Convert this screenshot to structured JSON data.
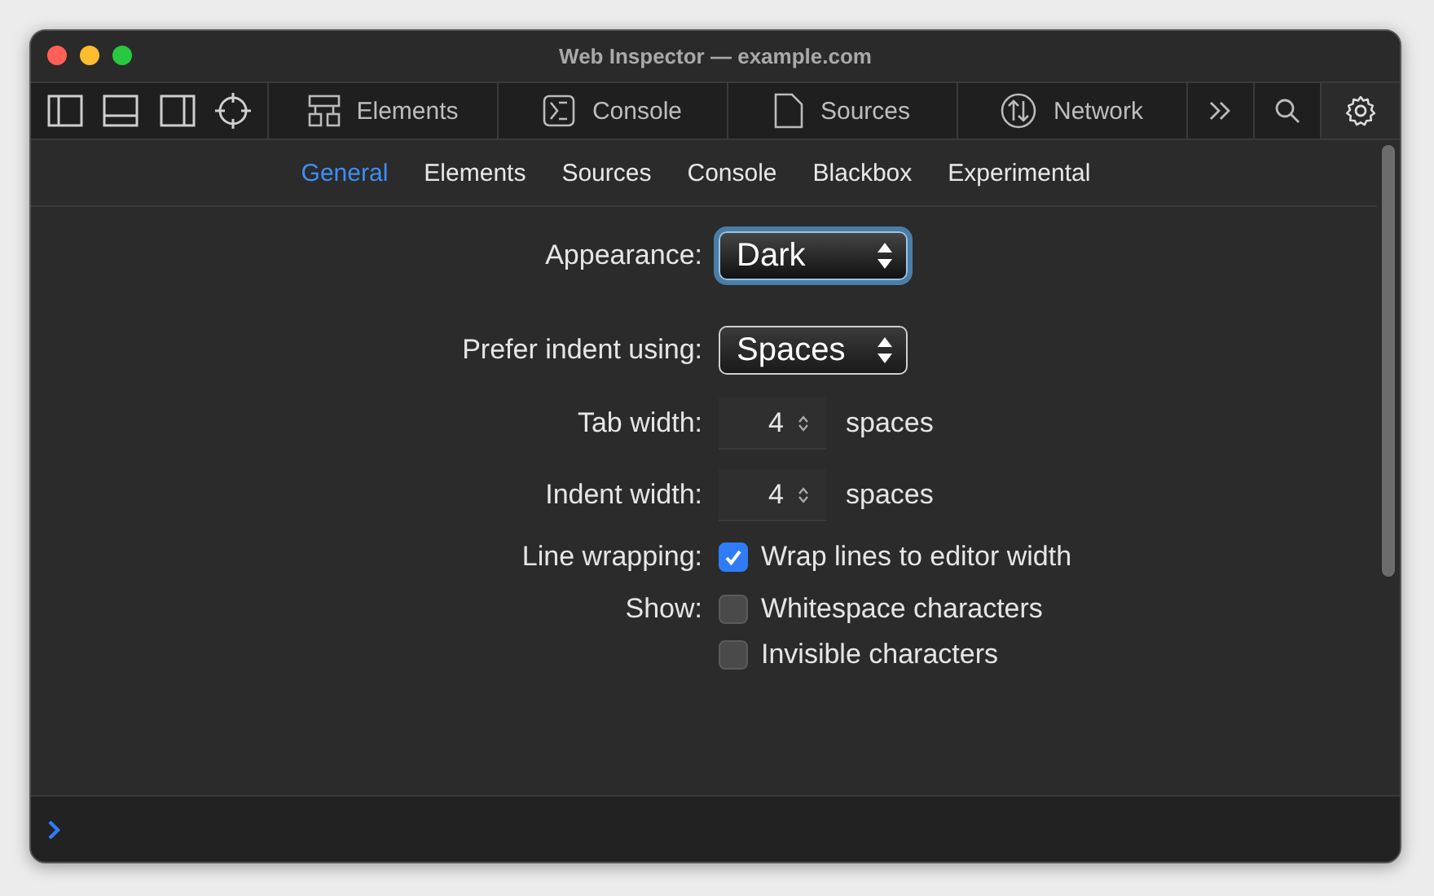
{
  "window": {
    "title": "Web Inspector — example.com"
  },
  "toolbar": {
    "tabs": [
      {
        "label": "Elements"
      },
      {
        "label": "Console"
      },
      {
        "label": "Sources"
      },
      {
        "label": "Network"
      }
    ]
  },
  "settings_tabs": [
    {
      "label": "General",
      "selected": true
    },
    {
      "label": "Elements",
      "selected": false
    },
    {
      "label": "Sources",
      "selected": false
    },
    {
      "label": "Console",
      "selected": false
    },
    {
      "label": "Blackbox",
      "selected": false
    },
    {
      "label": "Experimental",
      "selected": false
    }
  ],
  "settings": [
    {
      "kind": "select",
      "label": "Appearance:",
      "value": "Dark",
      "focused": true
    },
    {
      "kind": "select",
      "label": "Prefer indent using:",
      "value": "Spaces",
      "focused": false
    },
    {
      "kind": "stepper",
      "label": "Tab width:",
      "value": "4",
      "unit": "spaces"
    },
    {
      "kind": "stepper",
      "label": "Indent width:",
      "value": "4",
      "unit": "spaces"
    },
    {
      "kind": "checkboxes",
      "label": "Line wrapping:",
      "options": [
        {
          "label": "Wrap lines to editor width",
          "checked": true
        }
      ]
    },
    {
      "kind": "checkboxes",
      "label": "Show:",
      "options": [
        {
          "label": "Whitespace characters",
          "checked": false
        },
        {
          "label": "Invisible characters",
          "checked": false
        }
      ]
    }
  ]
}
